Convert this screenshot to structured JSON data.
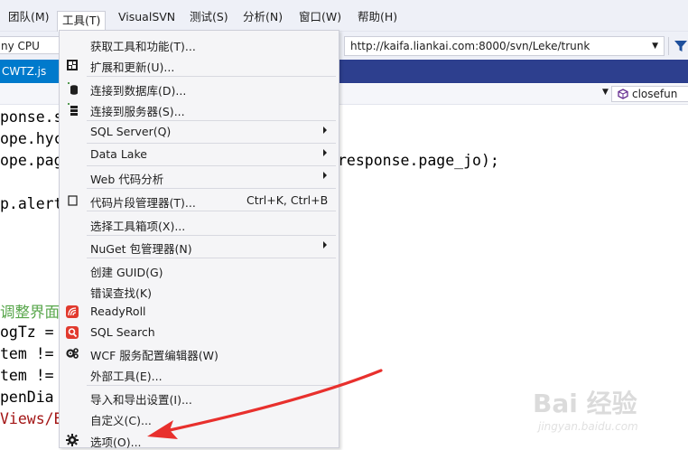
{
  "menubar": {
    "items": [
      {
        "label": "团队(M)"
      },
      {
        "label": "工具(T)",
        "active": true
      },
      {
        "label": "VisualSVN"
      },
      {
        "label": "测试(S)"
      },
      {
        "label": "分析(N)"
      },
      {
        "label": "窗口(W)"
      },
      {
        "label": "帮助(H)"
      }
    ]
  },
  "toolbar": {
    "platform": "ny CPU",
    "url": "http://kaifa.liankai.com:8000/svn/Leke/trunk",
    "filter_icon": "funnel-icon"
  },
  "tab": {
    "label": "CWTZ.js"
  },
  "navbar": {
    "member": "closefun"
  },
  "code": {
    "lines": [
      "ponse.s",
      "ope.hycv",
      "ope.page",
      "p.alert",
      "",
      "调整界面",
      "ogTz = ",
      "tem != ",
      "tem != ",
      "penDia",
      "Views/Ba"
    ],
    "fragment": "response.page_jo);"
  },
  "menu": {
    "items": [
      {
        "label": "获取工具和功能(T)...",
        "icon": ""
      },
      {
        "label": "扩展和更新(U)...",
        "icon": "extensions-icon"
      },
      {
        "label": "连接到数据库(D)...",
        "icon": "database-connect-icon"
      },
      {
        "label": "连接到服务器(S)...",
        "icon": "server-connect-icon"
      },
      {
        "label": "SQL Server(Q)",
        "submenu": true
      },
      {
        "label": "Data Lake",
        "submenu": true
      },
      {
        "label": "Web 代码分析",
        "submenu": true
      },
      {
        "label": "代码片段管理器(T)...",
        "shortcut": "Ctrl+K, Ctrl+B",
        "icon": "snippet-icon"
      },
      {
        "label": "选择工具箱项(X)..."
      },
      {
        "label": "NuGet 包管理器(N)",
        "submenu": true
      },
      {
        "label": "创建 GUID(G)"
      },
      {
        "label": "错误查找(K)"
      },
      {
        "label": "ReadyRoll",
        "icon": "readyroll-icon"
      },
      {
        "label": "SQL Search",
        "icon": "sql-search-icon"
      },
      {
        "label": "WCF 服务配置编辑器(W)",
        "icon": "wcf-config-icon"
      },
      {
        "label": "外部工具(E)..."
      },
      {
        "label": "导入和导出设置(I)..."
      },
      {
        "label": "自定义(C)..."
      },
      {
        "label": "选项(O)...",
        "icon": "gear-icon"
      }
    ]
  },
  "watermark": {
    "brand": "Bai 经验",
    "sub": "jingyan.baidu.com"
  },
  "colors": {
    "accent": "#007acc",
    "tabstrip": "#2d3f8e",
    "arrow": "#e8302d",
    "comment": "#57a64a"
  }
}
